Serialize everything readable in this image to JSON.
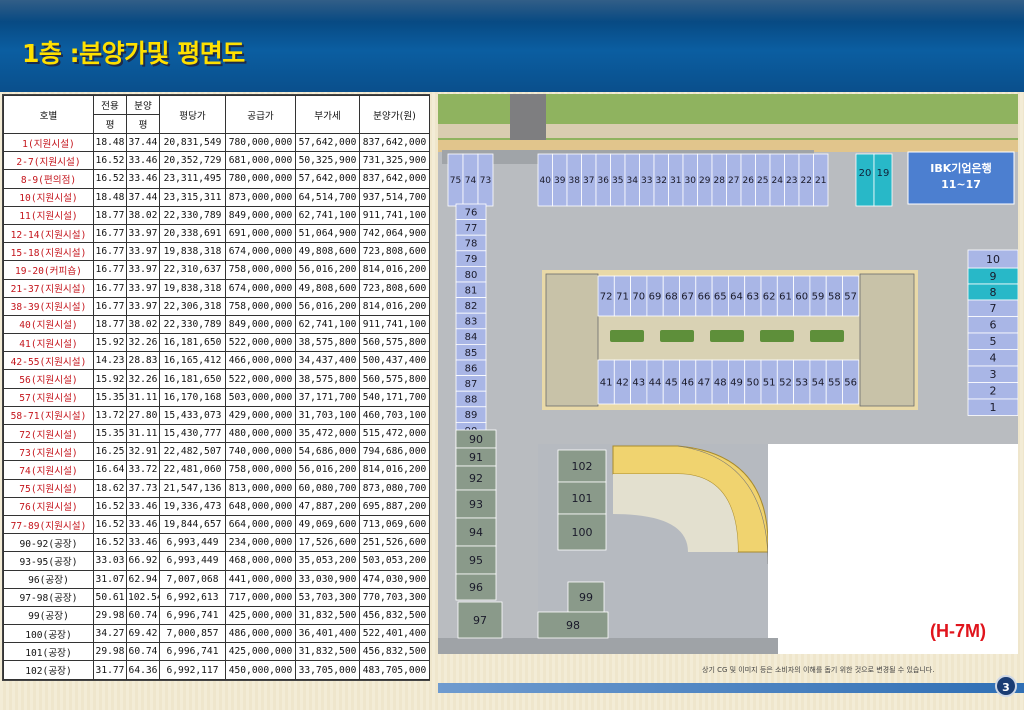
{
  "title": "1층 :분양가및 평면도",
  "table": {
    "headers": {
      "unit": "호별",
      "exclusive": "전용",
      "sale_area": "분양",
      "price_per_pyeong": "평당가",
      "supply_price": "공급가",
      "vat": "부가세",
      "sale_price": "분양가(원)",
      "pyeong1": "평",
      "pyeong2": "평"
    },
    "rows": [
      {
        "unit": "1(지원시설)",
        "exclusive": "18.48",
        "sale": "37.44",
        "ppp": "20,831,549",
        "supply": "780,000,000",
        "vat": "57,642,000",
        "price": "837,642,000",
        "tone": "red"
      },
      {
        "unit": "2-7(지원시설)",
        "exclusive": "16.52",
        "sale": "33.46",
        "ppp": "20,352,729",
        "supply": "681,000,000",
        "vat": "50,325,900",
        "price": "731,325,900",
        "tone": "red"
      },
      {
        "unit": "8-9(편의점)",
        "exclusive": "16.52",
        "sale": "33.46",
        "ppp": "23,311,495",
        "supply": "780,000,000",
        "vat": "57,642,000",
        "price": "837,642,000",
        "tone": "red"
      },
      {
        "unit": "10(지원시설)",
        "exclusive": "18.48",
        "sale": "37.44",
        "ppp": "23,315,311",
        "supply": "873,000,000",
        "vat": "64,514,700",
        "price": "937,514,700",
        "tone": "red"
      },
      {
        "unit": "11(지원시설)",
        "exclusive": "18.77",
        "sale": "38.02",
        "ppp": "22,330,789",
        "supply": "849,000,000",
        "vat": "62,741,100",
        "price": "911,741,100",
        "tone": "red"
      },
      {
        "unit": "12-14(지원시설)",
        "exclusive": "16.77",
        "sale": "33.97",
        "ppp": "20,338,691",
        "supply": "691,000,000",
        "vat": "51,064,900",
        "price": "742,064,900",
        "tone": "red"
      },
      {
        "unit": "15-18(지원시설)",
        "exclusive": "16.77",
        "sale": "33.97",
        "ppp": "19,838,318",
        "supply": "674,000,000",
        "vat": "49,808,600",
        "price": "723,808,600",
        "tone": "red"
      },
      {
        "unit": "19-20(커피숍)",
        "exclusive": "16.77",
        "sale": "33.97",
        "ppp": "22,310,637",
        "supply": "758,000,000",
        "vat": "56,016,200",
        "price": "814,016,200",
        "tone": "red"
      },
      {
        "unit": "21-37(지원시설)",
        "exclusive": "16.77",
        "sale": "33.97",
        "ppp": "19,838,318",
        "supply": "674,000,000",
        "vat": "49,808,600",
        "price": "723,808,600",
        "tone": "red"
      },
      {
        "unit": "38-39(지원시설)",
        "exclusive": "16.77",
        "sale": "33.97",
        "ppp": "22,306,318",
        "supply": "758,000,000",
        "vat": "56,016,200",
        "price": "814,016,200",
        "tone": "red"
      },
      {
        "unit": "40(지원시설)",
        "exclusive": "18.77",
        "sale": "38.02",
        "ppp": "22,330,789",
        "supply": "849,000,000",
        "vat": "62,741,100",
        "price": "911,741,100",
        "tone": "red"
      },
      {
        "unit": "41(지원시설)",
        "exclusive": "15.92",
        "sale": "32.26",
        "ppp": "16,181,650",
        "supply": "522,000,000",
        "vat": "38,575,800",
        "price": "560,575,800",
        "tone": "red"
      },
      {
        "unit": "42-55(지원시설)",
        "exclusive": "14.23",
        "sale": "28.83",
        "ppp": "16,165,412",
        "supply": "466,000,000",
        "vat": "34,437,400",
        "price": "500,437,400",
        "tone": "red"
      },
      {
        "unit": "56(지원시설)",
        "exclusive": "15.92",
        "sale": "32.26",
        "ppp": "16,181,650",
        "supply": "522,000,000",
        "vat": "38,575,800",
        "price": "560,575,800",
        "tone": "red"
      },
      {
        "unit": "57(지원시설)",
        "exclusive": "15.35",
        "sale": "31.11",
        "ppp": "16,170,168",
        "supply": "503,000,000",
        "vat": "37,171,700",
        "price": "540,171,700",
        "tone": "red"
      },
      {
        "unit": "58-71(지원시설)",
        "exclusive": "13.72",
        "sale": "27.80",
        "ppp": "15,433,073",
        "supply": "429,000,000",
        "vat": "31,703,100",
        "price": "460,703,100",
        "tone": "red"
      },
      {
        "unit": "72(지원시설)",
        "exclusive": "15.35",
        "sale": "31.11",
        "ppp": "15,430,777",
        "supply": "480,000,000",
        "vat": "35,472,000",
        "price": "515,472,000",
        "tone": "red"
      },
      {
        "unit": "73(지원시설)",
        "exclusive": "16.25",
        "sale": "32.91",
        "ppp": "22,482,507",
        "supply": "740,000,000",
        "vat": "54,686,000",
        "price": "794,686,000",
        "tone": "red"
      },
      {
        "unit": "74(지원시설)",
        "exclusive": "16.64",
        "sale": "33.72",
        "ppp": "22,481,060",
        "supply": "758,000,000",
        "vat": "56,016,200",
        "price": "814,016,200",
        "tone": "red"
      },
      {
        "unit": "75(지원시설)",
        "exclusive": "18.62",
        "sale": "37.73",
        "ppp": "21,547,136",
        "supply": "813,000,000",
        "vat": "60,080,700",
        "price": "873,080,700",
        "tone": "red"
      },
      {
        "unit": "76(지원시설)",
        "exclusive": "16.52",
        "sale": "33.46",
        "ppp": "19,336,473",
        "supply": "648,000,000",
        "vat": "47,887,200",
        "price": "695,887,200",
        "tone": "red"
      },
      {
        "unit": "77-89(지원시설)",
        "exclusive": "16.52",
        "sale": "33.46",
        "ppp": "19,844,657",
        "supply": "664,000,000",
        "vat": "49,069,600",
        "price": "713,069,600",
        "tone": "red"
      },
      {
        "unit": "90-92(공장)",
        "exclusive": "16.52",
        "sale": "33.46",
        "ppp": "6,993,449",
        "supply": "234,000,000",
        "vat": "17,526,600",
        "price": "251,526,600",
        "tone": "blk"
      },
      {
        "unit": "93-95(공장)",
        "exclusive": "33.03",
        "sale": "66.92",
        "ppp": "6,993,449",
        "supply": "468,000,000",
        "vat": "35,053,200",
        "price": "503,053,200",
        "tone": "blk"
      },
      {
        "unit": "96(공장)",
        "exclusive": "31.07",
        "sale": "62.94",
        "ppp": "7,007,068",
        "supply": "441,000,000",
        "vat": "33,030,900",
        "price": "474,030,900",
        "tone": "blk"
      },
      {
        "unit": "97-98(공장)",
        "exclusive": "50.61",
        "sale": "102.54",
        "ppp": "6,992,613",
        "supply": "717,000,000",
        "vat": "53,703,300",
        "price": "770,703,300",
        "tone": "blk"
      },
      {
        "unit": "99(공장)",
        "exclusive": "29.98",
        "sale": "60.74",
        "ppp": "6,996,741",
        "supply": "425,000,000",
        "vat": "31,832,500",
        "price": "456,832,500",
        "tone": "blk"
      },
      {
        "unit": "100(공장)",
        "exclusive": "34.27",
        "sale": "69.42",
        "ppp": "7,000,857",
        "supply": "486,000,000",
        "vat": "36,401,400",
        "price": "522,401,400",
        "tone": "blk"
      },
      {
        "unit": "101(공장)",
        "exclusive": "29.98",
        "sale": "60.74",
        "ppp": "6,996,741",
        "supply": "425,000,000",
        "vat": "31,832,500",
        "price": "456,832,500",
        "tone": "blk"
      },
      {
        "unit": "102(공장)",
        "exclusive": "31.77",
        "sale": "64.36",
        "ppp": "6,992,117",
        "supply": "450,000,000",
        "vat": "33,705,000",
        "price": "483,705,000",
        "tone": "blk"
      }
    ]
  },
  "plan": {
    "bank_label": "IBK기업은행",
    "bank_units": "11~17",
    "top_row_left": [
      "75",
      "74",
      "73"
    ],
    "top_row": [
      "40",
      "39",
      "38",
      "37",
      "36",
      "35",
      "34",
      "33",
      "32",
      "31",
      "30",
      "29",
      "28",
      "27",
      "26",
      "25",
      "24",
      "23",
      "22",
      "21"
    ],
    "top_highlight": [
      "20",
      "19"
    ],
    "left_col": [
      "76",
      "77",
      "78",
      "79",
      "80",
      "81",
      "82",
      "83",
      "84",
      "85",
      "86",
      "87",
      "88",
      "89",
      "90",
      "91",
      "92",
      "93",
      "94",
      "95",
      "96",
      "97"
    ],
    "right_highlight": [
      "9",
      "8"
    ],
    "right_col": [
      "10",
      "7",
      "6",
      "5",
      "4",
      "3",
      "2",
      "1"
    ],
    "center_top": [
      "72",
      "71",
      "70",
      "69",
      "68",
      "67",
      "66",
      "65",
      "64",
      "63",
      "62",
      "61",
      "60",
      "59",
      "58",
      "57"
    ],
    "center_bottom": [
      "41",
      "42",
      "43",
      "44",
      "45",
      "46",
      "47",
      "48",
      "49",
      "50",
      "51",
      "52",
      "53",
      "54",
      "55",
      "56"
    ],
    "factory_units": [
      "102",
      "101",
      "100",
      "99",
      "98"
    ],
    "colors": {
      "unit_fill": "#a9b6e6",
      "highlight_fill": "#28b8c8",
      "bank_fill": "#4c7fd0"
    }
  },
  "project_code": "(H-7M)",
  "disclaimer": "상기 CG 및 이미지 등은 소비자의 이해를 돕기 위한 것으로 변경될 수 있습니다.",
  "page_number": "3"
}
